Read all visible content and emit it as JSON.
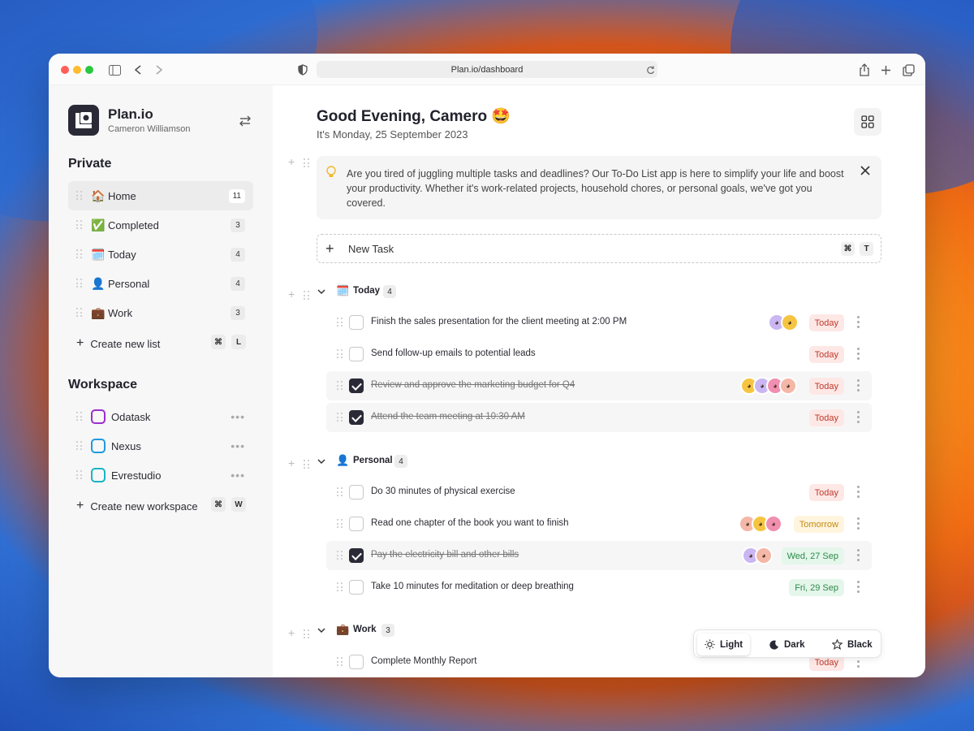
{
  "browser": {
    "url": "Plan.io/dashboard"
  },
  "app": {
    "name": "Plan.io",
    "user": "Cameron Williamson"
  },
  "sidebar": {
    "private_title": "Private",
    "items": [
      {
        "emoji": "🏠",
        "label": "Home",
        "count": "11"
      },
      {
        "emoji": "✅",
        "label": "Completed",
        "count": "3"
      },
      {
        "emoji": "🗓️",
        "label": "Today",
        "count": "4"
      },
      {
        "emoji": "👤",
        "label": "Personal",
        "count": "4"
      },
      {
        "emoji": "💼",
        "label": "Work",
        "count": "3"
      }
    ],
    "create_list": {
      "label": "Create new list",
      "key1": "⌘",
      "key2": "L"
    },
    "workspace_title": "Workspace",
    "workspaces": [
      {
        "label": "Odatask",
        "color": "#9b2fd0"
      },
      {
        "label": "Nexus",
        "color": "#1e9be0"
      },
      {
        "label": "Evrestudio",
        "color": "#18b6c2"
      }
    ],
    "create_workspace": {
      "label": "Create new workspace",
      "key1": "⌘",
      "key2": "W"
    }
  },
  "main": {
    "greeting": "Good Evening, Camero 🤩",
    "date": "It's Monday,  25 September 2023",
    "notice": "Are you tired of juggling multiple tasks and deadlines? Our To-Do List app is here to simplify your life and boost your productivity. Whether it's work-related projects, household chores, or personal goals, we've got you covered.",
    "new_task": {
      "label": "New Task",
      "key1": "⌘",
      "key2": "T"
    },
    "groups": [
      {
        "emoji": "🗓️",
        "label": "Today",
        "count": "4",
        "tasks": [
          {
            "text": "Finish the sales presentation for the client meeting at 2:00 PM",
            "done": false,
            "badge": "Today"
          },
          {
            "text": "Send follow-up emails to potential leads",
            "done": false,
            "badge": "Today"
          },
          {
            "text": "Review and approve the marketing budget for Q4",
            "done": true,
            "badge": "Today"
          },
          {
            "text": "Attend the team meeting at 10:30 AM",
            "done": true,
            "badge": "Today"
          }
        ]
      },
      {
        "emoji": "👤",
        "label": "Personal",
        "count": "4",
        "tasks": [
          {
            "text": "Do 30 minutes of physical exercise",
            "done": false,
            "badge": "Today"
          },
          {
            "text": "Read one chapter of the book you want to finish",
            "done": false,
            "badge": "Tomorrow"
          },
          {
            "text": "Pay the electricity bill and other bills",
            "done": true,
            "badge": "Wed, 27 Sep"
          },
          {
            "text": "Take 10 minutes for meditation or deep breathing",
            "done": false,
            "badge": "Fri, 29 Sep"
          }
        ]
      },
      {
        "emoji": "💼",
        "label": "Work",
        "count": "3",
        "tasks": [
          {
            "text": "Complete Monthly Report",
            "done": false,
            "badge": "Today"
          }
        ]
      }
    ]
  },
  "theme_switcher": {
    "light": "Light",
    "dark": "Dark",
    "black": "Black",
    "selected": "Light"
  },
  "colors": {
    "accent": "#2a2a37",
    "today_badge": "#c0392b",
    "tomorrow_badge": "#c58a10",
    "date_badge": "#2e8a4c"
  }
}
